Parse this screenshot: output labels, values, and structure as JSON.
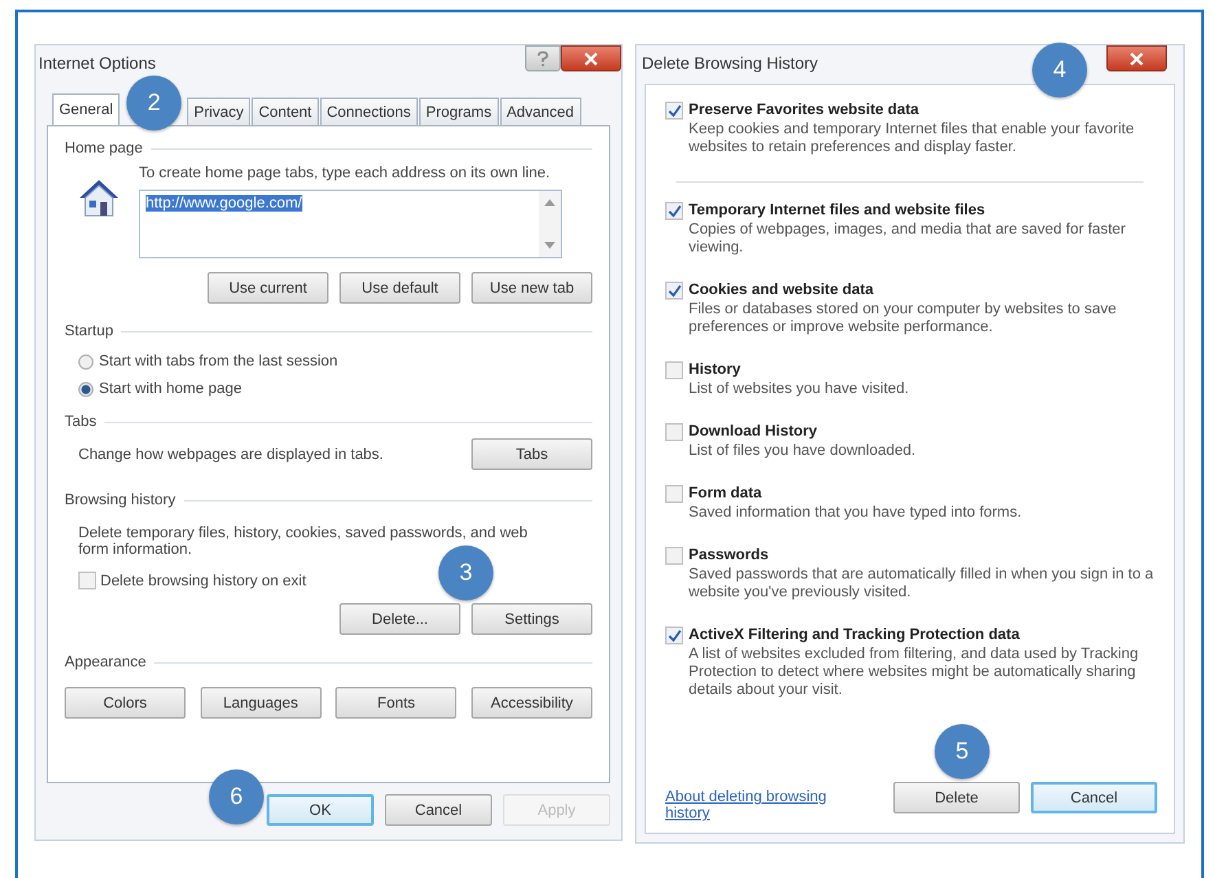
{
  "internet_options": {
    "title": "Internet Options",
    "tabs": [
      {
        "label": "General",
        "selected": true,
        "callout": "2"
      },
      {
        "label": "Privacy",
        "selected": false
      },
      {
        "label": "Content",
        "selected": false
      },
      {
        "label": "Connections",
        "selected": false
      },
      {
        "label": "Programs",
        "selected": false
      },
      {
        "label": "Advanced",
        "selected": false
      }
    ],
    "home_page": {
      "heading": "Home page",
      "hint": "To create home page tabs, type each address on its own line.",
      "value": "http://www.google.com/",
      "buttons": [
        "Use current",
        "Use default",
        "Use new tab"
      ]
    },
    "startup": {
      "heading": "Startup",
      "options": [
        {
          "label": "Start with tabs from the last session",
          "selected": false
        },
        {
          "label": "Start with home page",
          "selected": true
        }
      ]
    },
    "tabs_section": {
      "heading": "Tabs",
      "text": "Change how webpages are displayed in tabs.",
      "button": "Tabs"
    },
    "browsing_history": {
      "heading": "Browsing history",
      "text": "Delete temporary files, history, cookies, saved passwords, and web form information.",
      "checkbox": {
        "label": "Delete browsing history on exit",
        "checked": false
      },
      "buttons": [
        {
          "label": "Delete...",
          "callout": "3"
        },
        {
          "label": "Settings"
        }
      ]
    },
    "appearance": {
      "heading": "Appearance",
      "buttons": [
        "Colors",
        "Languages",
        "Fonts",
        "Accessibility"
      ]
    },
    "footer_buttons": [
      {
        "label": "OK",
        "focused": true,
        "disabled": false,
        "callout": "6"
      },
      {
        "label": "Cancel",
        "focused": false,
        "disabled": false
      },
      {
        "label": "Apply",
        "focused": false,
        "disabled": true
      }
    ]
  },
  "delete_history": {
    "title": "Delete Browsing History",
    "callout": "4",
    "preserve_option": {
      "title": "Preserve Favorites website data",
      "description": "Keep cookies and temporary Internet files that enable your favorite websites to retain preferences and display faster.",
      "checked": true
    },
    "options": [
      {
        "title": "Temporary Internet files and website files",
        "description": "Copies of webpages, images, and media that are saved for faster viewing.",
        "checked": true
      },
      {
        "title": "Cookies and website data",
        "description": "Files or databases stored on your computer by websites to save preferences or improve website performance.",
        "checked": true
      },
      {
        "title": "History",
        "description": "List of websites you have visited.",
        "checked": false
      },
      {
        "title": "Download History",
        "description": "List of files you have downloaded.",
        "checked": false
      },
      {
        "title": "Form data",
        "description": "Saved information that you have typed into forms.",
        "checked": false
      },
      {
        "title": "Passwords",
        "description": "Saved passwords that are automatically filled in when you sign in to a website you've previously visited.",
        "checked": false
      },
      {
        "title": "ActiveX Filtering and Tracking Protection data",
        "description": "A list of websites excluded from filtering, and data used by Tracking Protection to detect where websites might be automatically sharing details about your visit.",
        "checked": true
      }
    ],
    "link": "About deleting browsing history",
    "buttons": [
      {
        "label": "Delete",
        "focused": false,
        "callout": "5"
      },
      {
        "label": "Cancel",
        "focused": true
      }
    ]
  }
}
